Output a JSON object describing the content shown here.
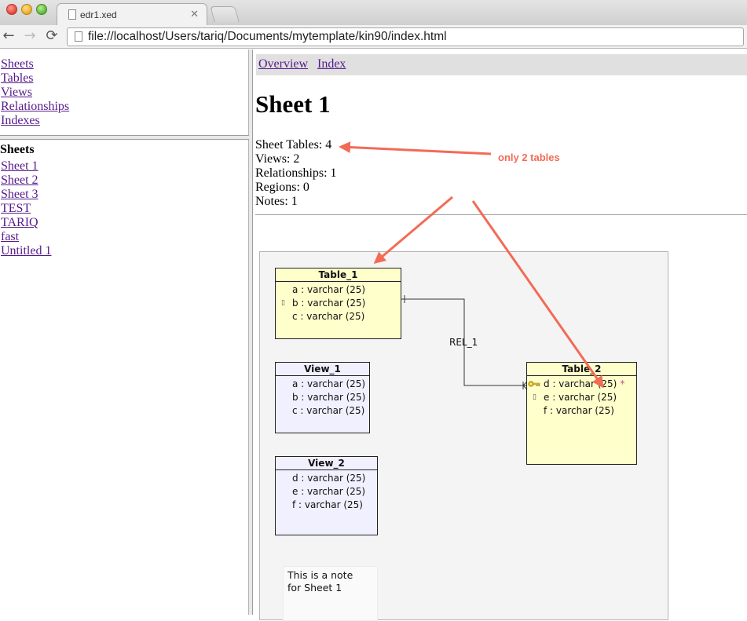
{
  "browser": {
    "tab_title": "edr1.xed",
    "tab_close": "✕",
    "url": "file://localhost/Users/tariq/Documents/mytemplate/kin90/index.html",
    "back": "←",
    "forward": "→",
    "reload": "⟳"
  },
  "nav_frame": {
    "items": [
      {
        "label": "Sheets"
      },
      {
        "label": "Tables"
      },
      {
        "label": "Views"
      },
      {
        "label": "Relationships"
      },
      {
        "label": "Indexes"
      }
    ]
  },
  "sheets_frame": {
    "heading": "Sheets",
    "items": [
      {
        "label": "Sheet 1"
      },
      {
        "label": "Sheet 2"
      },
      {
        "label": "Sheet 3"
      },
      {
        "label": "TEST"
      },
      {
        "label": "TARIQ"
      },
      {
        "label": "fast"
      },
      {
        "label": "Untitled 1"
      }
    ]
  },
  "main": {
    "top_nav": {
      "overview": "Overview",
      "index": "Index"
    },
    "title": "Sheet 1",
    "stats": [
      "Sheet Tables: 4",
      "Views: 2",
      "Relationships: 1",
      "Regions: 0",
      "Notes: 1"
    ]
  },
  "diagram": {
    "tables": [
      {
        "name": "Table_1",
        "columns": [
          {
            "text": "a : varchar (25)",
            "marker": ""
          },
          {
            "text": "b : varchar (25)",
            "marker": "index"
          },
          {
            "text": "c : varchar (25)",
            "marker": ""
          }
        ]
      },
      {
        "name": "Table_2",
        "columns": [
          {
            "text": "d : varchar (25)",
            "marker": "key",
            "required": "*"
          },
          {
            "text": "e : varchar (25)",
            "marker": "index"
          },
          {
            "text": "f : varchar (25)",
            "marker": ""
          }
        ]
      }
    ],
    "views": [
      {
        "name": "View_1",
        "columns": [
          {
            "text": "a : varchar (25)"
          },
          {
            "text": "b : varchar (25)"
          },
          {
            "text": "c : varchar (25)"
          }
        ]
      },
      {
        "name": "View_2",
        "columns": [
          {
            "text": "d : varchar (25)"
          },
          {
            "text": "e : varchar (25)"
          },
          {
            "text": "f : varchar (25)"
          }
        ]
      }
    ],
    "relationship_label": "REL_1",
    "note_lines": [
      "This is a note",
      "for Sheet 1"
    ]
  },
  "annotation": {
    "text": "only 2 tables",
    "color": "#f26b57"
  },
  "colors": {
    "link_visited": "#551a8b",
    "table_fill": "#ffffcc",
    "view_fill": "#f0f0ff",
    "canvas_fill": "#f4f4f4"
  }
}
